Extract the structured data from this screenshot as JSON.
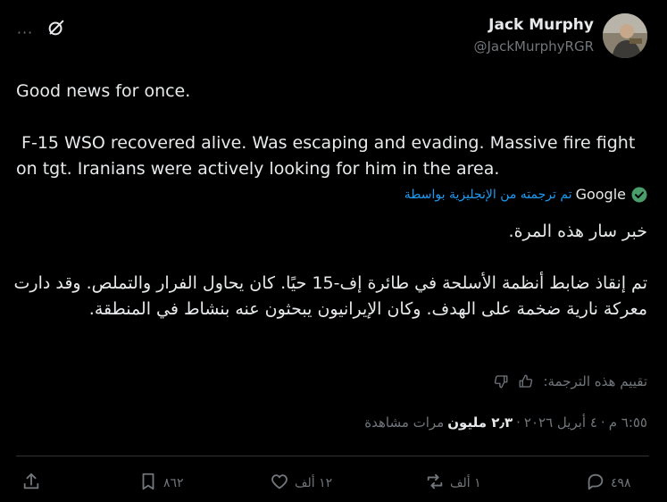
{
  "header": {
    "more_label": "···",
    "author_name": "Jack Murphy",
    "author_handle": "@JackMurphyRGR"
  },
  "tweet": {
    "line1": "Good news for once.",
    "line2": " F-15 WSO recovered alive. Was escaping and evading. Massive fire fight on tgt. Iranians were actively looking for him in the area."
  },
  "translation": {
    "provider": "Google",
    "label": "تم ترجمته من الإنجليزية بواسطة",
    "ar_line1": "خبر سار هذه المرة.",
    "ar_line2": "تم إنقاذ ضابط أنظمة الأسلحة في طائرة إف-15 حيًا. كان يحاول الفرار والتملص. وقد دارت معركة نارية ضخمة على الهدف. وكان الإيرانيون يبحثون عنه بنشاط في المنطقة.",
    "rate_label": "تقييم هذه الترجمة:"
  },
  "meta": {
    "time": "٦:٥٥ م",
    "sep": "·",
    "date": "٤ أبريل ٢٠٢٦",
    "views_count": "٢٫٣ مليون",
    "views_label": "مرات مشاهدة"
  },
  "actions": {
    "replies": "٤٩٨",
    "reposts": "١ ألف",
    "likes": "١٢ ألف",
    "bookmarks": "٨٦٢"
  },
  "colors": {
    "background": "#000000",
    "text": "#e7e9ea",
    "secondary": "#71767b",
    "link": "#1d9bf0",
    "divider": "#2f3336"
  }
}
